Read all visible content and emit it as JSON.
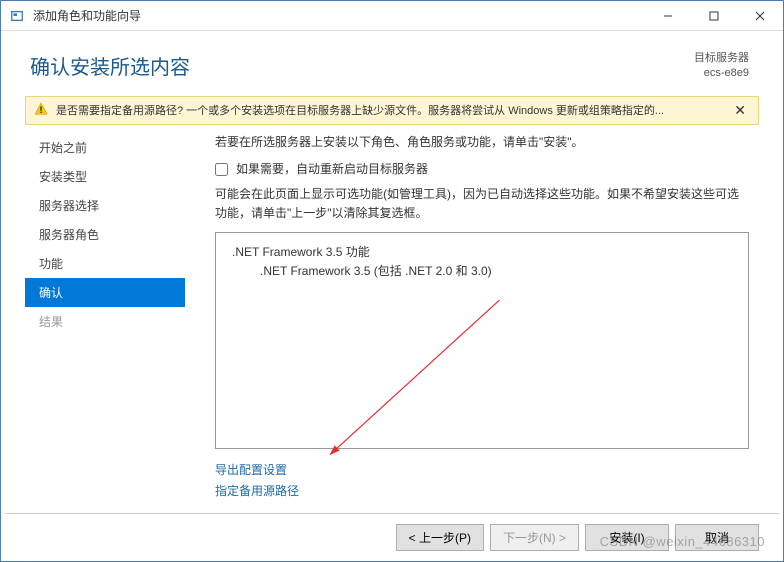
{
  "titlebar": {
    "title": "添加角色和功能向导"
  },
  "header": {
    "page_title": "确认安装所选内容",
    "target_label": "目标服务器",
    "target_value": "ecs-e8e9"
  },
  "warning": {
    "text": "是否需要指定备用源路径? 一个或多个安装选项在目标服务器上缺少源文件。服务器将尝试从 Windows 更新或组策略指定的..."
  },
  "sidebar": {
    "items": [
      {
        "label": "开始之前"
      },
      {
        "label": "安装类型"
      },
      {
        "label": "服务器选择"
      },
      {
        "label": "服务器角色"
      },
      {
        "label": "功能"
      },
      {
        "label": "确认"
      },
      {
        "label": "结果"
      }
    ]
  },
  "panel": {
    "intro": "若要在所选服务器上安装以下角色、角色服务或功能，请单击\"安装\"。",
    "checkbox_label": "如果需要，自动重新启动目标服务器",
    "hint": "可能会在此页面上显示可选功能(如管理工具)，因为已自动选择这些功能。如果不希望安装这些可选功能，请单击\"上一步\"以清除其复选框。",
    "features": {
      "parent": ".NET Framework 3.5 功能",
      "child": ".NET Framework 3.5 (包括 .NET 2.0 和 3.0)"
    },
    "link_export": "导出配置设置",
    "link_source": "指定备用源路径"
  },
  "footer": {
    "prev": "< 上一步(P)",
    "next": "下一步(N) >",
    "install": "安装(I)",
    "cancel": "取消"
  },
  "watermark": "CSDN @weixin_44686310"
}
